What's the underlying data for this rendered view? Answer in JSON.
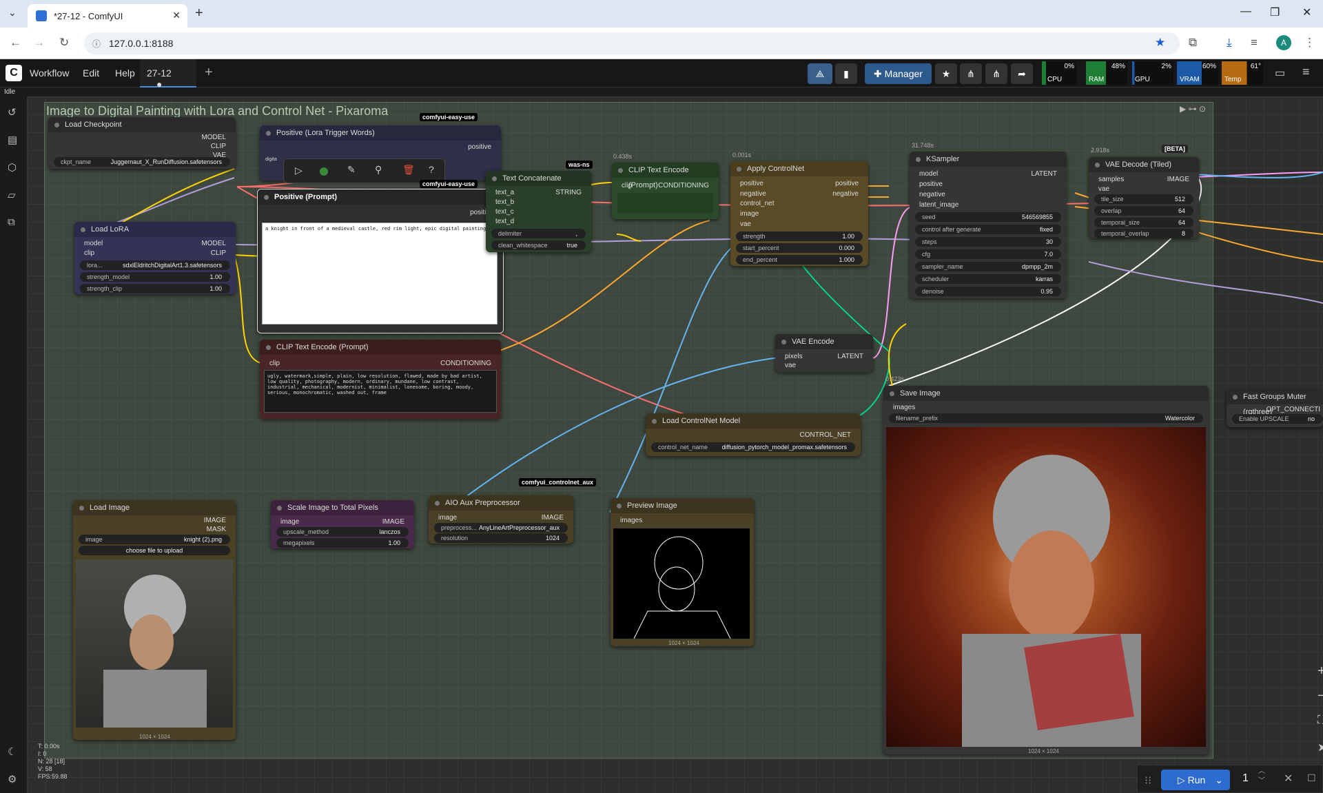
{
  "browser": {
    "tab_title": "*27-12 - ComfyUI",
    "url": "127.0.0.1:8188"
  },
  "menu": {
    "workflow": "Workflow",
    "edit": "Edit",
    "help": "Help",
    "tab": "27-12",
    "manager": "Manager"
  },
  "meters": {
    "cpu_label": "CPU",
    "cpu": "0%",
    "ram_label": "RAM",
    "ram": "48%",
    "gpu_label": "GPU",
    "gpu": "2%",
    "vram_label": "VRAM",
    "vram": "60%",
    "temp_label": "Temp",
    "temp": "61°"
  },
  "status": "Idle",
  "group_title": "Image to Digital Painting with Lora and Control Net - Pixaroma",
  "badges": {
    "easy1": "comfyui-easy-use",
    "easy2": "comfyui-easy-use",
    "wasns": "was-ns",
    "aux": "comfyui_controlnet_aux",
    "beta": "[BETA]"
  },
  "timings": {
    "clip": "0.438s",
    "apply": "0.001s",
    "ksampler": "31.748s",
    "vae": "2.918s",
    "save": "0.423s"
  },
  "nodes": {
    "load_checkpoint": {
      "title": "Load Checkpoint",
      "out1": "MODEL",
      "out2": "CLIP",
      "out3": "VAE",
      "w_label": "ckpt_name",
      "w_value": "Juggernaut_X_RunDiffusion.safetensors"
    },
    "load_lora": {
      "title": "Load LoRA",
      "in1": "model",
      "in2": "clip",
      "out1": "MODEL",
      "out2": "CLIP",
      "w1_label": "lora...",
      "w1_value": "sdxlEldritchDigitalArt1.3.safetensors",
      "w2_label": "strength_model",
      "w2_value": "1.00",
      "w3_label": "strength_clip",
      "w3_value": "1.00"
    },
    "pos_lora": {
      "title": "Positive (Lora Trigger Words)",
      "out": "positive",
      "text": "digita"
    },
    "pos_prompt": {
      "title": "Positive (Prompt)",
      "out": "positive",
      "text": "a knight in front of a medieval castle, red rim light, epic digital painting"
    },
    "clip_neg": {
      "title": "CLIP Text Encode (Prompt)",
      "in": "clip",
      "out": "CONDITIONING",
      "text": "ugly, watermark,simple, plain, low resolution, flawed, made by bad artist, low quality, photography, modern, ordinary, mundane, low contrast, industrial, mechanical, modernist, minimalist, lonesome, boring, moody, serious, monochromatic, washed out, frame"
    },
    "text_concat": {
      "title": "Text Concatenate",
      "in1": "text_a",
      "in2": "text_b",
      "in3": "text_c",
      "in4": "text_d",
      "out": "STRING",
      "w1_label": "delimiter",
      "w1_value": ",",
      "w2_label": "clean_whitespace",
      "w2_value": "true"
    },
    "clip_pos": {
      "title": "CLIP Text Encode (Prompt)",
      "in1": "clip",
      "out": "CONDITIONING"
    },
    "apply_cn": {
      "title": "Apply ControlNet",
      "in1": "positive",
      "in2": "negative",
      "in3": "control_net",
      "in4": "image",
      "in5": "vae",
      "out1": "positive",
      "out2": "negative",
      "w1_label": "strength",
      "w1_value": "1.00",
      "w2_label": "start_percent",
      "w2_value": "0.000",
      "w3_label": "end_percent",
      "w3_value": "1.000"
    },
    "ksampler": {
      "title": "KSampler",
      "in1": "model",
      "in2": "positive",
      "in3": "negative",
      "in4": "latent_image",
      "out": "LATENT",
      "w": [
        [
          "seed",
          "546569855"
        ],
        [
          "control after generate",
          "fixed"
        ],
        [
          "steps",
          "30"
        ],
        [
          "cfg",
          "7.0"
        ],
        [
          "sampler_name",
          "dpmpp_2m"
        ],
        [
          "scheduler",
          "karras"
        ],
        [
          "denoise",
          "0.95"
        ]
      ]
    },
    "vae_decode": {
      "title": "VAE Decode (Tiled)",
      "in1": "samples",
      "in2": "vae",
      "out": "IMAGE",
      "w": [
        [
          "tile_size",
          "512"
        ],
        [
          "overlap",
          "64"
        ],
        [
          "temporal_size",
          "64"
        ],
        [
          "temporal_overlap",
          "8"
        ]
      ]
    },
    "vae_encode": {
      "title": "VAE Encode",
      "in1": "pixels",
      "in2": "vae",
      "out": "LATENT"
    },
    "load_cn": {
      "title": "Load ControlNet Model",
      "out": "CONTROL_NET",
      "w_label": "control_net_name",
      "w_value": "diffusion_pytorch_model_promax.safetensors"
    },
    "save_image": {
      "title": "Save Image",
      "in": "images",
      "w_label": "filename_prefix",
      "w_value": "Watercolor",
      "dims": "1024 × 1024"
    },
    "fast_groups": {
      "title": "Fast Groups Muter (rgthree)",
      "opt": "OPT_CONNECTI",
      "w_label": "Enable UPSCALE",
      "w_value": "no"
    },
    "load_image": {
      "title": "Load Image",
      "out1": "IMAGE",
      "out2": "MASK",
      "w_label": "image",
      "w_value": "knight (2).png",
      "upload": "choose file to upload",
      "dims": "1024 × 1024"
    },
    "scale_image": {
      "title": "Scale Image to Total Pixels",
      "in": "image",
      "out": "IMAGE",
      "w1_label": "upscale_method",
      "w1_value": "lanczos",
      "w2_label": "megapixels",
      "w2_value": "1.00"
    },
    "aio_aux": {
      "title": "AIO Aux Preprocessor",
      "in": "image",
      "out": "IMAGE",
      "w1_label": "preprocess...",
      "w1_value": "AnyLineArtPreprocessor_aux",
      "w2_label": "resolution",
      "w2_value": "1024"
    },
    "preview": {
      "title": "Preview Image",
      "in": "images",
      "dims": "1024 × 1024"
    }
  },
  "stats": {
    "t": "T: 0.00s",
    "i": "I: 0",
    "n": "N: 28 [18]",
    "v": "V: 58",
    "fps": "FPS:59.88"
  },
  "run": {
    "label": "Run",
    "count": "1"
  },
  "colors": {
    "accent": "#2e6bd0",
    "model": "#b39ddb",
    "clip": "#ffd500",
    "vae": "#ff6e6e",
    "cond": "#ffa931",
    "latent": "#ff9cf9",
    "image": "#64b5f6",
    "cnet": "#00d78d"
  }
}
